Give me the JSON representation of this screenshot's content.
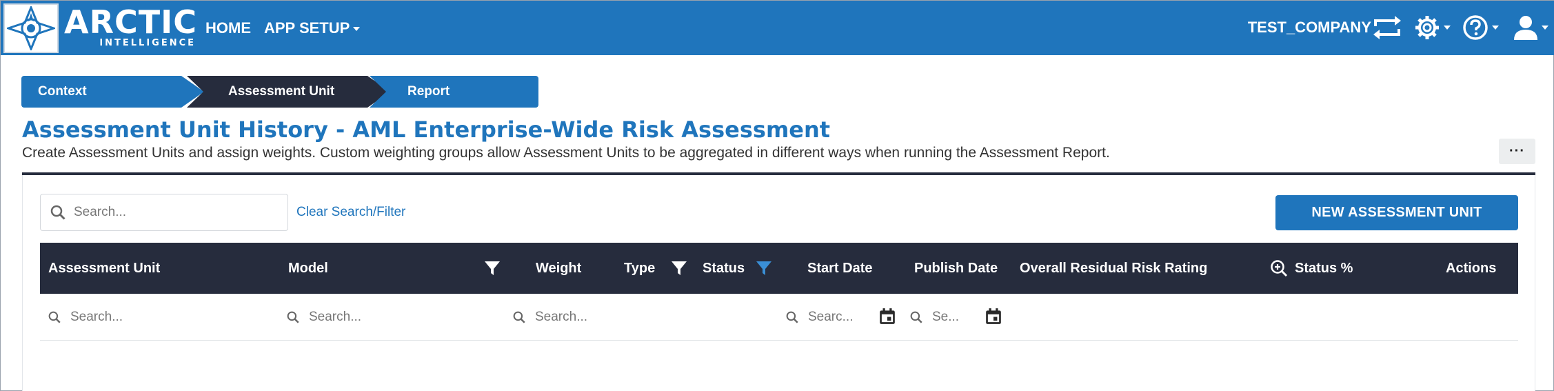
{
  "brand": {
    "name": "ARCTIC",
    "tagline": "INTELLIGENCE"
  },
  "nav": {
    "home": "HOME",
    "app_setup": "APP SETUP",
    "company": "TEST_COMPANY"
  },
  "stepper": {
    "steps": [
      {
        "label": "Context",
        "state": "default"
      },
      {
        "label": "Assessment Unit",
        "state": "active"
      },
      {
        "label": "Report",
        "state": "default"
      }
    ]
  },
  "page": {
    "title": "Assessment Unit History - AML Enterprise-Wide Risk Assessment",
    "description": "Create Assessment Units and assign weights. Custom weighting groups allow Assessment Units to be aggregated in different ways when running the Assessment Report.",
    "more_label": "···"
  },
  "toolbar": {
    "search_placeholder": "Search...",
    "clear_label": "Clear Search/Filter",
    "new_button": "NEW ASSESSMENT UNIT"
  },
  "table": {
    "columns": {
      "assessment_unit": "Assessment Unit",
      "model": "Model",
      "weight": "Weight",
      "type": "Type",
      "status": "Status",
      "start_date": "Start Date",
      "publish_date": "Publish Date",
      "overall_rating": "Overall Residual Risk Rating",
      "status_pct": "Status %",
      "actions": "Actions"
    },
    "filters": {
      "assessment_unit": "Search...",
      "model": "Search...",
      "weight": "Search...",
      "start_date": "Searc...",
      "publish_date": "Se..."
    },
    "rows": []
  },
  "colors": {
    "brand_blue": "#1f75bc",
    "dark_navy": "#262c3d",
    "status_filter_active": "#1f75bc"
  },
  "icons": [
    "logo-compass-icon",
    "switch-arrows-icon",
    "gear-icon",
    "help-icon",
    "user-icon",
    "search-icon",
    "filter-icon",
    "zoom-in-icon",
    "calendar-icon"
  ]
}
